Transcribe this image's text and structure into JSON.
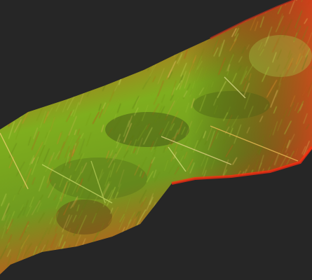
{
  "image": {
    "kind": "3d point cloud scan",
    "description_for_accessibility": "",
    "colors": {
      "background": "#262626",
      "edge_red": "#e0281a",
      "mid_orange": "#c86a1e",
      "core_green": "#7fae1e",
      "bright_yellow": "#e3d26a"
    }
  }
}
